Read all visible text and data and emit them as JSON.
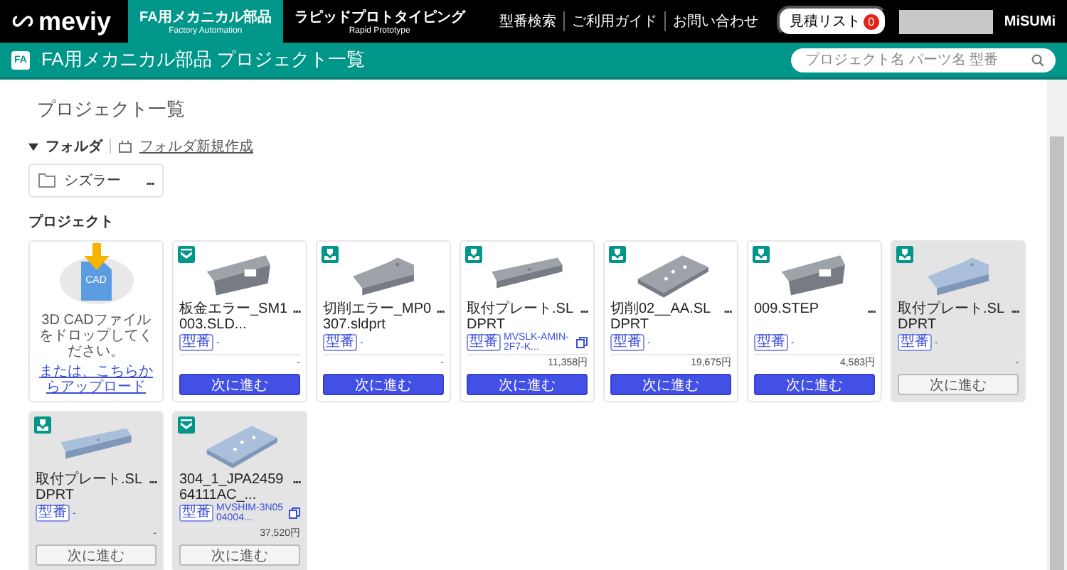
{
  "header": {
    "logo": "meviy",
    "tabs": [
      {
        "label": "FA用メカニカル部品",
        "sublabel": "Factory Automation",
        "selected": true
      },
      {
        "label": "ラピッドプロトタイピング",
        "sublabel": "Rapid Prototype",
        "selected": false
      }
    ],
    "links": [
      "型番検索",
      "ご利用ガイド",
      "お問い合わせ"
    ],
    "quote_button": {
      "label": "見積リスト",
      "count": "0"
    },
    "brand": "MiSUMi"
  },
  "title_bar": {
    "badge": "FA",
    "title": "FA用メカニカル部品 プロジェクト一覧",
    "search": {
      "placeholder": "プロジェクト名 パーツ名 型番"
    }
  },
  "page_title": "プロジェクト一覧",
  "folders": {
    "heading": "フォルダ",
    "expanded": true,
    "new_folder": "フォルダ新規作成",
    "items": [
      {
        "name": "シズラー",
        "menu": "..."
      }
    ]
  },
  "projects": {
    "heading": "プロジェクト",
    "upload": {
      "badge": "CAD",
      "message": "3D CADファイルをドロップしてください。",
      "link": "または、こちらからアップロード"
    },
    "items": [
      {
        "kind": "sheet_metal",
        "name": "板金エラー_SM1003.SLD...",
        "menu": "...",
        "part_label": "型番",
        "part_number": "-",
        "copyable": false,
        "price": "-",
        "button": "次に進む",
        "disabled": false
      },
      {
        "kind": "cutting",
        "name": "切削エラー_MP0307.sldprt",
        "menu": "...",
        "part_label": "型番",
        "part_number": "-",
        "copyable": false,
        "price": "-",
        "button": "次に進む",
        "disabled": false
      },
      {
        "kind": "cutting",
        "name": "取付プレート.SLDPRT",
        "menu": "...",
        "part_label": "型番",
        "part_number": "MVSLK-AMIN-2F7-K...",
        "copyable": true,
        "price": "11,358円",
        "button": "次に進む",
        "disabled": false
      },
      {
        "kind": "cutting",
        "name": "切削02__AA.SLDPRT",
        "menu": "...",
        "part_label": "型番",
        "part_number": "-",
        "copyable": false,
        "price": "19,675円",
        "button": "次に進む",
        "disabled": false
      },
      {
        "kind": "cutting",
        "name": "009.STEP",
        "menu": "...",
        "part_label": "型番",
        "part_number": "-",
        "copyable": false,
        "price": "4,583円",
        "button": "次に進む",
        "disabled": false
      },
      {
        "kind": "cutting",
        "name": "取付プレート.SLDPRT",
        "menu": "...",
        "part_label": "型番",
        "part_number": "-",
        "copyable": false,
        "price": "-",
        "button": "次に進む",
        "disabled": true
      },
      {
        "kind": "cutting",
        "name": "取付プレート.SLDPRT",
        "menu": "...",
        "part_label": "型番",
        "part_number": "-",
        "copyable": false,
        "price": "-",
        "button": "次に進む",
        "disabled": true
      },
      {
        "kind": "sheet_metal",
        "name": "304_1_JPA245964111AC_...",
        "menu": "...",
        "part_label": "型番",
        "part_number": "MVSHIM-3N0504004...",
        "copyable": true,
        "price": "37,520円",
        "button": "次に進む",
        "disabled": true
      }
    ]
  }
}
